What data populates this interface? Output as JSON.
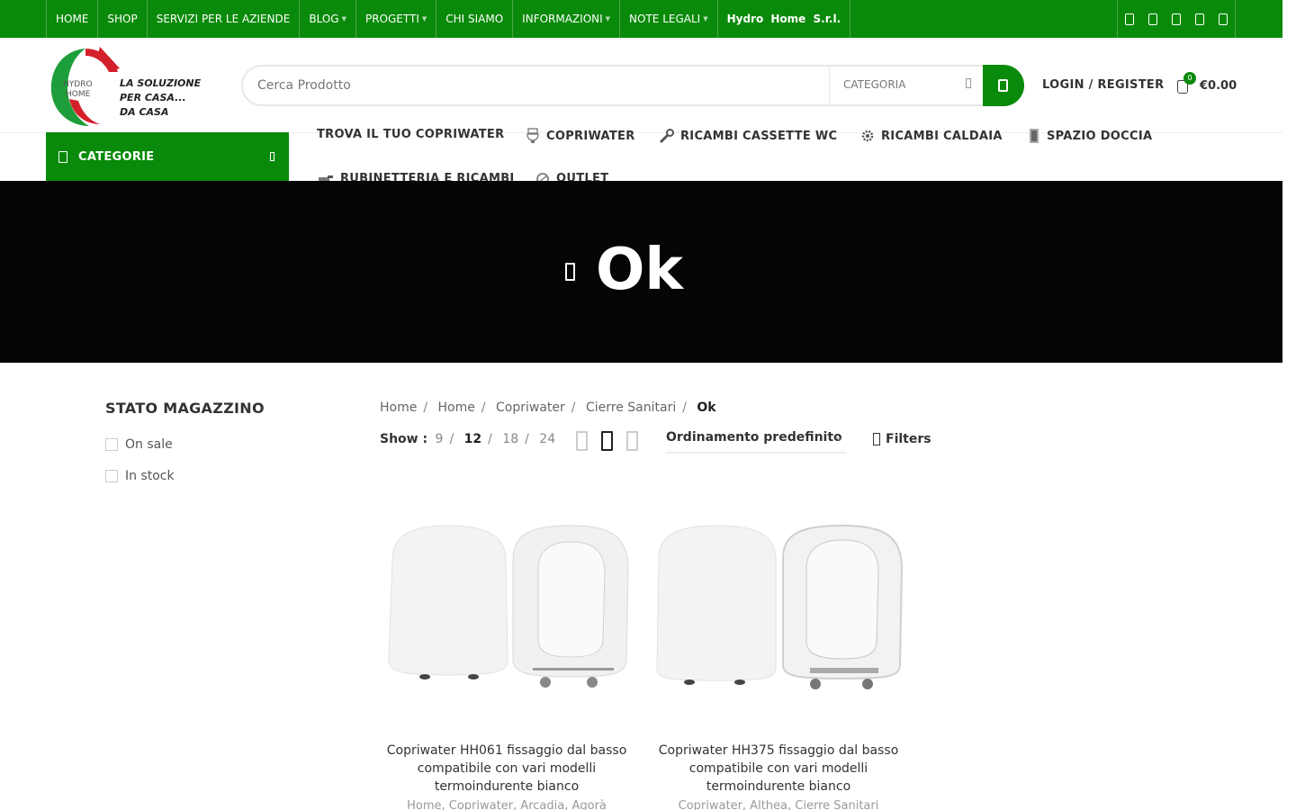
{
  "topbar": {
    "nav": [
      {
        "label": "HOME",
        "caret": false
      },
      {
        "label": "SHOP",
        "caret": false
      },
      {
        "label": "SERVIZI PER LE AZIENDE",
        "caret": false
      },
      {
        "label": "BLOG",
        "caret": true
      },
      {
        "label": "PROGETTI",
        "caret": true
      },
      {
        "label": "CHI SIAMO",
        "caret": false
      },
      {
        "label": "INFORMAZIONI",
        "caret": true
      },
      {
        "label": "NOTE LEGALI",
        "caret": true
      },
      {
        "label": "Hydro Home S.r.l.",
        "caret": false
      }
    ],
    "social_icons": [
      "facebook-icon",
      "twitter-icon",
      "instagram-icon",
      "pinterest-icon",
      "linkedin-icon"
    ]
  },
  "header": {
    "logo": {
      "brand_line1": "HYDRO",
      "brand_line2": "HOME",
      "tagline1": "LA SOLUZIONE",
      "tagline2": "PER CASA...",
      "tagline3": "DA CASA"
    },
    "search_placeholder": "Cerca Prodotto",
    "category_label": "CATEGORIA",
    "login_label": "LOGIN / REGISTER",
    "cart_count": "0",
    "cart_total": "€0.00"
  },
  "categories_label": "CATEGORIE",
  "main_nav": [
    {
      "label": "TROVA IL TUO COPRIWATER",
      "icon": "none"
    },
    {
      "label": "COPRIWATER",
      "icon": "toilet-icon"
    },
    {
      "label": "RICAMBI CASSETTE WC",
      "icon": "wrench-icon"
    },
    {
      "label": "RICAMBI CALDAIA",
      "icon": "gear-icon"
    },
    {
      "label": "SPAZIO DOCCIA",
      "icon": "shower-icon"
    },
    {
      "label": "RUBINETTERIA E RICAMBI",
      "icon": "faucet-icon"
    },
    {
      "label": "OUTLET",
      "icon": "outlet-icon"
    }
  ],
  "hero": {
    "title": "Ok"
  },
  "sidebar": {
    "title": "STATO MAGAZZINO",
    "items": [
      "On sale",
      "In stock"
    ]
  },
  "breadcrumb": [
    "Home",
    "Home",
    "Copriwater",
    "Cierre Sanitari"
  ],
  "breadcrumb_current": "Ok",
  "toolbar": {
    "show_label": "Show :",
    "show_options": [
      "9",
      "12",
      "18",
      "24"
    ],
    "show_selected": "12",
    "sort_label": "Ordinamento predefinito",
    "filters_label": "Filters"
  },
  "products": [
    {
      "title": "Copriwater HH061 fissaggio dal basso compatibile con vari modelli termoindurente bianco",
      "categories": "Home, Copriwater, Arcadia, Agorà"
    },
    {
      "title": "Copriwater HH375 fissaggio dal basso compatibile con vari modelli termoindurente bianco",
      "categories": "Copriwater, Althea, Cierre Sanitari"
    }
  ],
  "colors": {
    "brand_green": "#0a8a0a",
    "hero_bg": "#050505"
  }
}
